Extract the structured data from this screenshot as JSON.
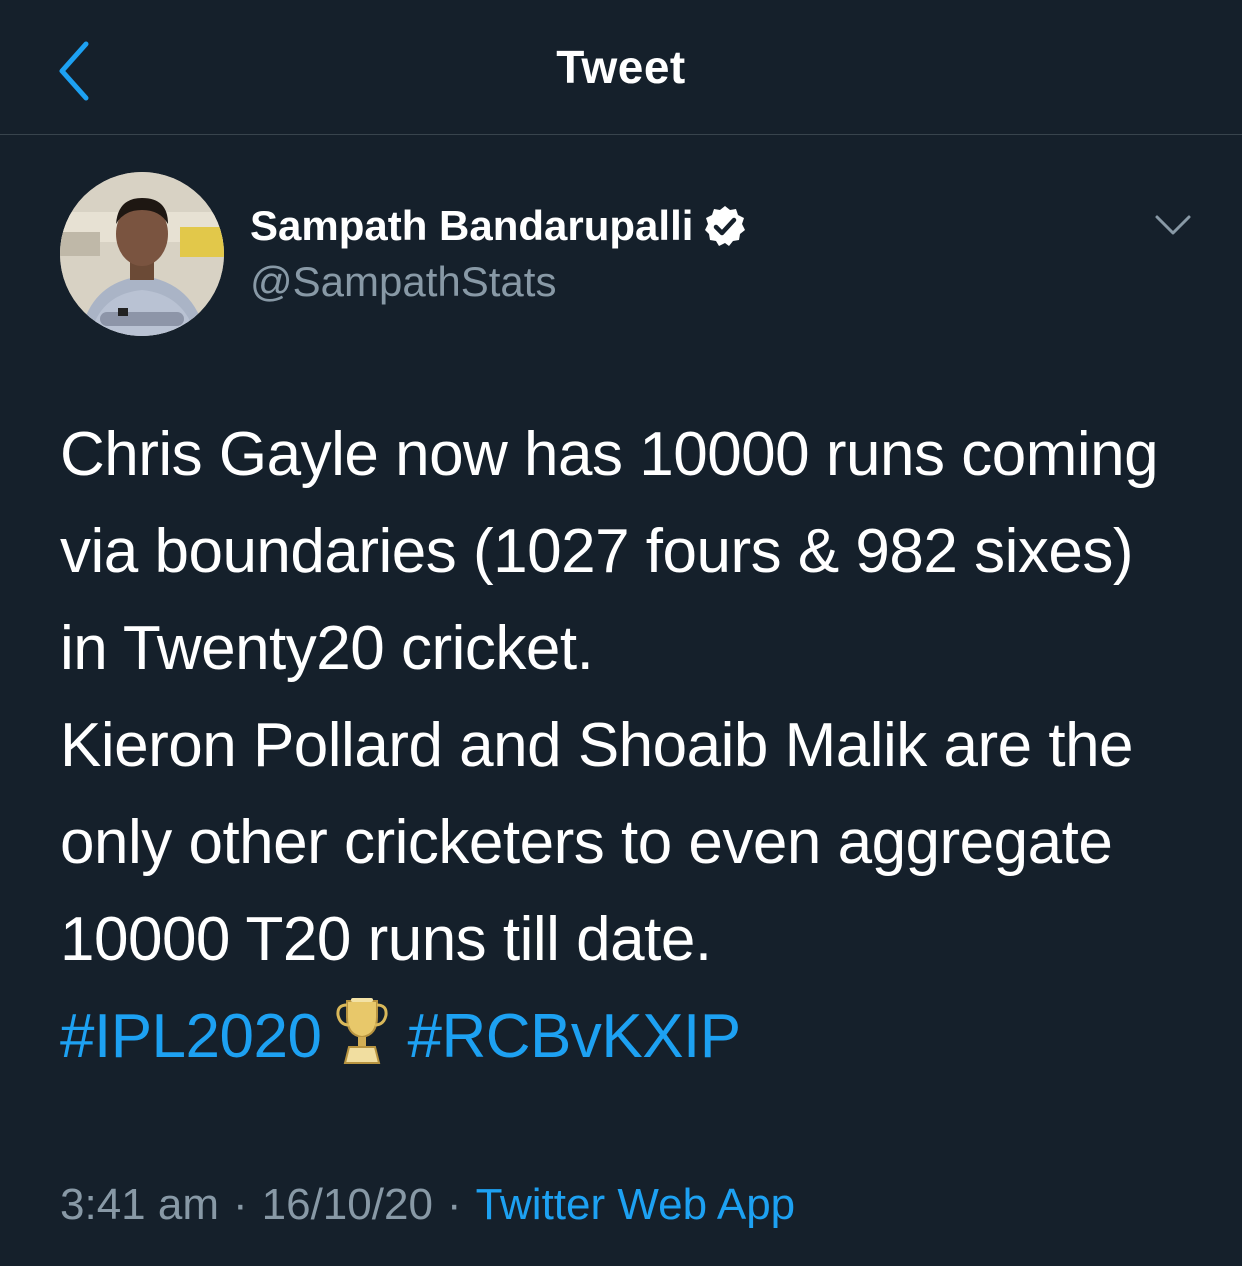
{
  "header": {
    "title": "Tweet",
    "back_icon": "chevron-left-icon"
  },
  "author": {
    "name": "Sampath Bandarupalli",
    "handle": "@SampathStats",
    "verified": true
  },
  "tweet": {
    "paragraph1": "Chris Gayle now has 10000 runs coming via boundaries (1027 fours & 982 sixes) in Twenty20 cricket.",
    "paragraph2": "Kieron Pollard and Shoaib Malik are the only other cricketers to even aggregate 10000 T20 runs till date.",
    "hashtags": [
      "#IPL2020",
      "#RCBvKXIP"
    ]
  },
  "meta": {
    "time": "3:41 am",
    "separator": "·",
    "date": "16/10/20",
    "source": "Twitter Web App"
  },
  "colors": {
    "background": "#15202b",
    "accent": "#1da1f2",
    "secondary_text": "#8899a6",
    "divider": "#38444d"
  }
}
